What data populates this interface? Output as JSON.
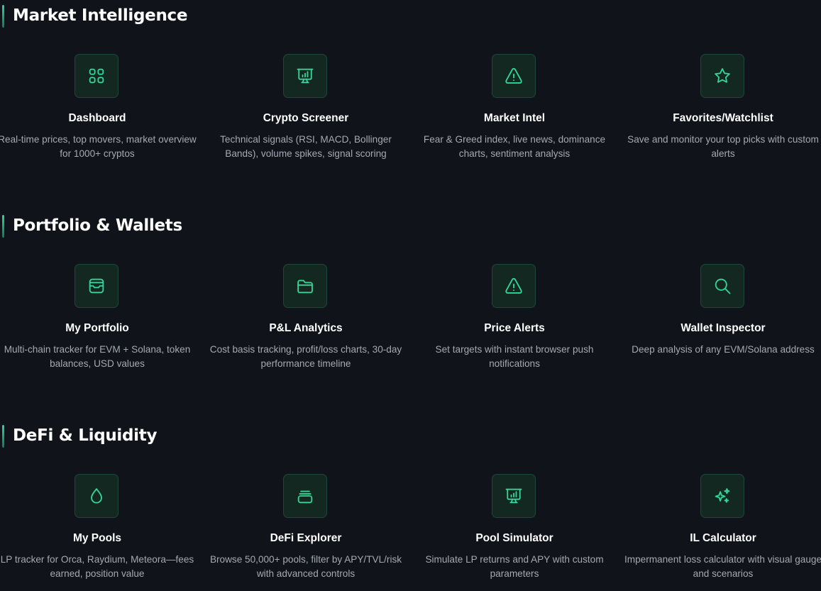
{
  "sections": [
    {
      "title": "Market Intelligence",
      "cards": [
        {
          "icon": "grid-icon",
          "title": "Dashboard",
          "desc": "Real-time prices, top movers, market overview for 1000+ cryptos"
        },
        {
          "icon": "presentation-chart-icon",
          "title": "Crypto Screener",
          "desc": "Technical signals (RSI, MACD, Bollinger Bands), volume spikes, signal scoring"
        },
        {
          "icon": "warning-triangle-icon",
          "title": "Market Intel",
          "desc": "Fear & Greed index, live news, dominance charts, sentiment analysis"
        },
        {
          "icon": "star-icon",
          "title": "Favorites/Watchlist",
          "desc": "Save and monitor your top picks with custom alerts"
        }
      ]
    },
    {
      "title": "Portfolio & Wallets",
      "cards": [
        {
          "icon": "wallet-icon",
          "title": "My Portfolio",
          "desc": "Multi-chain tracker for EVM + Solana, token balances, USD values"
        },
        {
          "icon": "folder-icon",
          "title": "P&L Analytics",
          "desc": "Cost basis tracking, profit/loss charts, 30-day performance timeline"
        },
        {
          "icon": "warning-triangle-icon",
          "title": "Price Alerts",
          "desc": "Set targets with instant browser push notifications"
        },
        {
          "icon": "search-icon",
          "title": "Wallet Inspector",
          "desc": "Deep analysis of any EVM/Solana address"
        }
      ]
    },
    {
      "title": "DeFi & Liquidity",
      "cards": [
        {
          "icon": "droplet-icon",
          "title": "My Pools",
          "desc": "LP tracker for Orca, Raydium, Meteora—fees earned, position value"
        },
        {
          "icon": "stack-icon",
          "title": "DeFi Explorer",
          "desc": "Browse 50,000+ pools, filter by APY/TVL/risk with advanced controls"
        },
        {
          "icon": "presentation-chart-icon",
          "title": "Pool Simulator",
          "desc": "Simulate LP returns and APY with custom parameters"
        },
        {
          "icon": "sparkles-icon",
          "title": "IL Calculator",
          "desc": "Impermanent loss calculator with visual gauge and scenarios"
        }
      ]
    }
  ],
  "colors": {
    "background": "#10131a",
    "accent": "#34d399",
    "icon_box": "#132820",
    "description": "#a4a9b3"
  }
}
